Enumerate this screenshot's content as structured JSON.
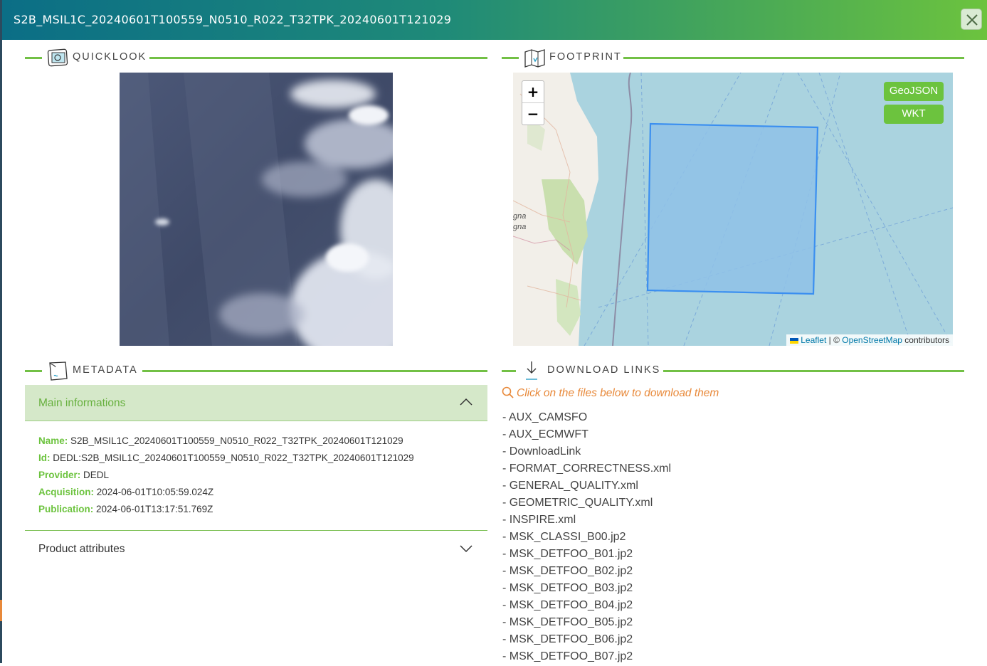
{
  "header": {
    "title": "S2B_MSIL1C_20240601T100559_N0510_R022_T32TPK_20240601T121029",
    "close_icon": "close-icon"
  },
  "sections": {
    "quicklook": "QUICKLOOK",
    "footprint": "FOOTPRINT",
    "metadata": "METADATA",
    "download_links": "DOWNLOAD LINKS"
  },
  "map": {
    "zoom_in": "+",
    "zoom_out": "−",
    "geojson_button": "GeoJSON",
    "wkt_button": "WKT",
    "attribution_leaflet": "Leaflet",
    "attribution_sep": " | © ",
    "attribution_osm": "OpenStreetMap",
    "attribution_tail": " contributors",
    "place_label_1": "gna",
    "place_label_2": "gna",
    "footprint_fill": "#8fc1e8",
    "footprint_stroke": "#3b8ff0"
  },
  "metadata": {
    "main_title": "Main informations",
    "fields": {
      "name_key": "Name:",
      "name_val": "S2B_MSIL1C_20240601T100559_N0510_R022_T32TPK_20240601T121029",
      "id_key": "Id:",
      "id_val": "DEDL:S2B_MSIL1C_20240601T100559_N0510_R022_T32TPK_20240601T121029",
      "provider_key": "Provider:",
      "provider_val": "DEDL",
      "acquisition_key": "Acquisition:",
      "acquisition_val": "2024-06-01T10:05:59.024Z",
      "publication_key": "Publication:",
      "publication_val": "2024-06-01T13:17:51.769Z"
    },
    "attributes_title": "Product attributes"
  },
  "downloads": {
    "hint": "Click on the files below to download them",
    "items": [
      "- AUX_CAMSFO",
      "- AUX_ECMWFT",
      "- DownloadLink",
      "- FORMAT_CORRECTNESS.xml",
      "- GENERAL_QUALITY.xml",
      "- GEOMETRIC_QUALITY.xml",
      "- INSPIRE.xml",
      "- MSK_CLASSI_B00.jp2",
      "- MSK_DETFOO_B01.jp2",
      "- MSK_DETFOO_B02.jp2",
      "- MSK_DETFOO_B03.jp2",
      "- MSK_DETFOO_B04.jp2",
      "- MSK_DETFOO_B05.jp2",
      "- MSK_DETFOO_B06.jp2",
      "- MSK_DETFOO_B07.jp2"
    ]
  },
  "colors": {
    "accent_green": "#6cc33e",
    "header_start": "#0b6e86",
    "hint_orange": "#e8893a"
  }
}
